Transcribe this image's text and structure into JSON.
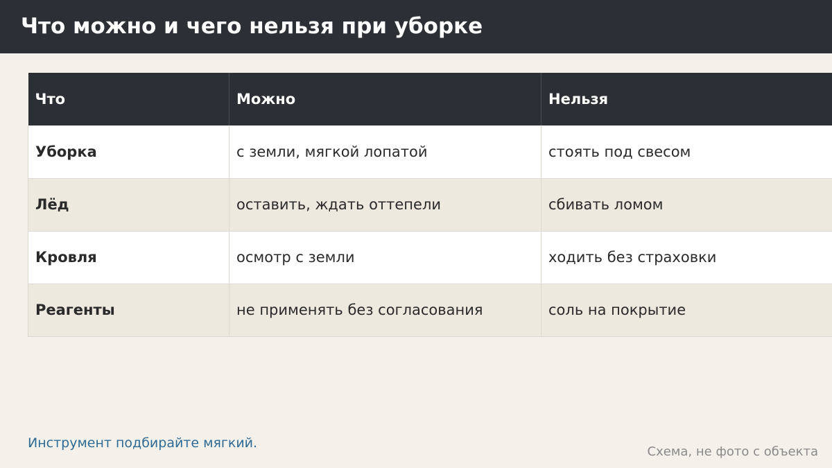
{
  "title": "Что можно и чего нельзя при уборке",
  "table": {
    "headers": [
      "Что",
      "Можно",
      "Нельзя"
    ],
    "rows": [
      {
        "topic": "Уборка",
        "allowed": "с земли, мягкой лопатой",
        "forbidden": "стоять под свесом"
      },
      {
        "topic": "Лёд",
        "allowed": "оставить, ждать оттепели",
        "forbidden": "сбивать ломом"
      },
      {
        "topic": "Кровля",
        "allowed": "осмотр с земли",
        "forbidden": "ходить без страховки"
      },
      {
        "topic": "Реагенты",
        "allowed": "не применять без согласования",
        "forbidden": "соль на покрытие"
      }
    ]
  },
  "hint": "Инструмент подбирайте мягкий.",
  "caption": "Схема, не фото с объекта",
  "colors": {
    "header_bg": "#2c2f35",
    "page_bg": "#f4f1eb",
    "row_alt_bg": "#ede9df",
    "hint_text": "#2f6a94",
    "caption_text": "#8a8a8a"
  }
}
